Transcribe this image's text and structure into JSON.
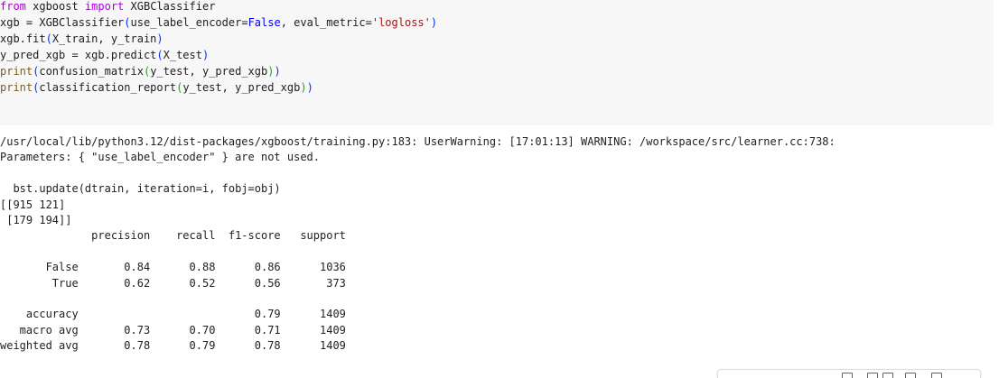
{
  "code_cell": {
    "lines": [
      [
        {
          "t": "from",
          "c": "kw"
        },
        {
          "t": " xgboost ",
          "c": ""
        },
        {
          "t": "import",
          "c": "kw"
        },
        {
          "t": " XGBClassifier",
          "c": ""
        }
      ],
      [
        {
          "t": "xgb = XGBClassifier",
          "c": ""
        },
        {
          "t": "(",
          "c": "paren1"
        },
        {
          "t": "use_label_encoder=",
          "c": ""
        },
        {
          "t": "False",
          "c": "const"
        },
        {
          "t": ", eval_metric=",
          "c": ""
        },
        {
          "t": "'logloss'",
          "c": "str"
        },
        {
          "t": ")",
          "c": "paren1"
        }
      ],
      [
        {
          "t": "xgb.fit",
          "c": ""
        },
        {
          "t": "(",
          "c": "paren1"
        },
        {
          "t": "X_train, y_train",
          "c": ""
        },
        {
          "t": ")",
          "c": "paren1"
        }
      ],
      [
        {
          "t": "y_pred_xgb = xgb.predict",
          "c": ""
        },
        {
          "t": "(",
          "c": "paren1"
        },
        {
          "t": "X_test",
          "c": ""
        },
        {
          "t": ")",
          "c": "paren1"
        }
      ],
      [
        {
          "t": "print",
          "c": "fn"
        },
        {
          "t": "(",
          "c": "paren1"
        },
        {
          "t": "confusion_matrix",
          "c": ""
        },
        {
          "t": "(",
          "c": "paren2"
        },
        {
          "t": "y_test, y_pred_xgb",
          "c": ""
        },
        {
          "t": ")",
          "c": "paren2"
        },
        {
          "t": ")",
          "c": "paren1"
        }
      ],
      [
        {
          "t": "print",
          "c": "fn"
        },
        {
          "t": "(",
          "c": "paren1"
        },
        {
          "t": "classification_report",
          "c": ""
        },
        {
          "t": "(",
          "c": "paren2"
        },
        {
          "t": "y_test, y_pred_xgb",
          "c": ""
        },
        {
          "t": ")",
          "c": "paren2"
        },
        {
          "t": ")",
          "c": "paren1"
        }
      ]
    ]
  },
  "output": {
    "lines": [
      "/usr/local/lib/python3.12/dist-packages/xgboost/training.py:183: UserWarning: [17:01:13] WARNING: /workspace/src/learner.cc:738: ",
      "Parameters: { \"use_label_encoder\" } are not used.",
      "",
      "  bst.update(dtrain, iteration=i, fobj=obj)",
      "[[915 121]",
      " [179 194]]",
      "              precision    recall  f1-score   support",
      "",
      "       False       0.84      0.88      0.86      1036",
      "        True       0.62      0.52      0.56       373",
      "",
      "    accuracy                           0.79      1409",
      "   macro avg       0.73      0.70      0.71      1409",
      "weighted avg       0.78      0.79      0.78      1409"
    ]
  },
  "toolbar": {
    "icons": [
      "cell-action-icon",
      "copy-icon",
      "link-icon",
      "edit-icon",
      "delete-icon"
    ]
  }
}
